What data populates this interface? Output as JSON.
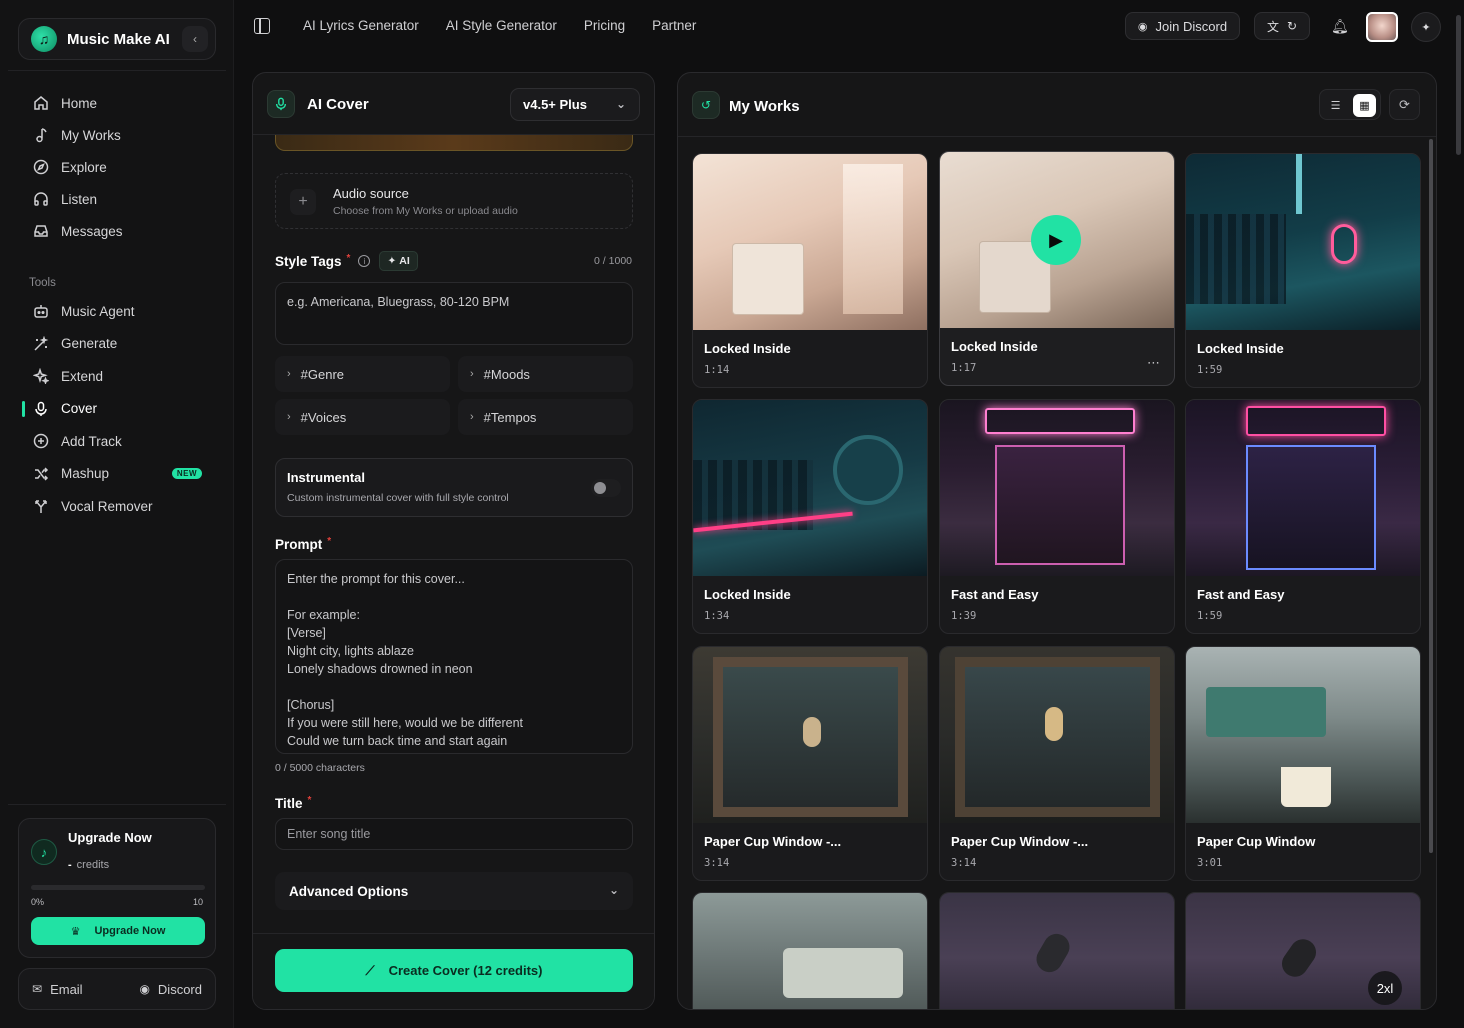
{
  "brand": {
    "name": "Music Make AI"
  },
  "nav": {
    "main": [
      {
        "label": "Home",
        "icon": "home-icon"
      },
      {
        "label": "My Works",
        "icon": "music-note-icon"
      },
      {
        "label": "Explore",
        "icon": "compass-icon"
      },
      {
        "label": "Listen",
        "icon": "headphones-icon"
      },
      {
        "label": "Messages",
        "icon": "inbox-icon"
      }
    ],
    "tools_label": "Tools",
    "tools": [
      {
        "label": "Music Agent",
        "icon": "bot-icon"
      },
      {
        "label": "Generate",
        "icon": "wand-icon"
      },
      {
        "label": "Extend",
        "icon": "sparkles-icon"
      },
      {
        "label": "Cover",
        "icon": "microphone-icon",
        "active": true
      },
      {
        "label": "Add Track",
        "icon": "plus-circle-icon"
      },
      {
        "label": "Mashup",
        "icon": "shuffle-icon",
        "badge": "NEW"
      },
      {
        "label": "Vocal Remover",
        "icon": "split-icon"
      }
    ]
  },
  "upgrade": {
    "title": "Upgrade Now",
    "credits_value": "-",
    "credits_label": "credits",
    "progress_min": "0%",
    "progress_max": "10",
    "progress_fraction": 0,
    "button": "Upgrade Now"
  },
  "contact": {
    "email": "Email",
    "discord": "Discord"
  },
  "topbar": {
    "links": [
      "AI Lyrics Generator",
      "AI Style Generator",
      "Pricing",
      "Partner"
    ],
    "discord_button": "Join Discord"
  },
  "cover": {
    "title": "AI Cover",
    "version": "v4.5+ Plus",
    "audio_source_title": "Audio source",
    "audio_source_hint": "Choose from My Works or upload audio",
    "style_tags_label": "Style Tags",
    "required_mark": "*",
    "ai_chip": "AI",
    "style_counter": "0 / 1000",
    "style_placeholder": "e.g. Americana, Bluegrass, 80-120 BPM",
    "tags": [
      "#Genre",
      "#Moods",
      "#Voices",
      "#Tempos"
    ],
    "instrumental_title": "Instrumental",
    "instrumental_desc": "Custom instrumental cover with full style control",
    "instrumental_on": false,
    "prompt_label": "Prompt",
    "prompt_placeholder": [
      "Enter the prompt for this cover...",
      "",
      "For example:",
      "[Verse]",
      "Night city, lights ablaze",
      "Lonely shadows drowned in neon",
      "",
      "[Chorus]",
      "If you were still here, would we be different",
      "Could we turn back time and start again"
    ],
    "prompt_counter": "0 / 5000 characters",
    "title_label": "Title",
    "title_placeholder": "Enter song title",
    "advanced": "Advanced Options",
    "create_button": "Create Cover (12 credits)"
  },
  "works": {
    "title": "My Works",
    "items": [
      {
        "title": "Locked Inside",
        "duration": "1:14"
      },
      {
        "title": "Locked Inside",
        "duration": "1:17"
      },
      {
        "title": "Locked Inside",
        "duration": "1:59"
      },
      {
        "title": "Locked Inside",
        "duration": "1:34"
      },
      {
        "title": "Fast and Easy",
        "duration": "1:39"
      },
      {
        "title": "Fast and Easy",
        "duration": "1:59"
      },
      {
        "title": "Paper Cup Window -...",
        "duration": "3:14"
      },
      {
        "title": "Paper Cup Window -...",
        "duration": "3:14"
      },
      {
        "title": "Paper Cup Window",
        "duration": "3:01"
      }
    ],
    "badge": "2xl"
  },
  "colors": {
    "accent": "#21e2a4",
    "background": "#0f0f10",
    "panel": "#161617"
  }
}
